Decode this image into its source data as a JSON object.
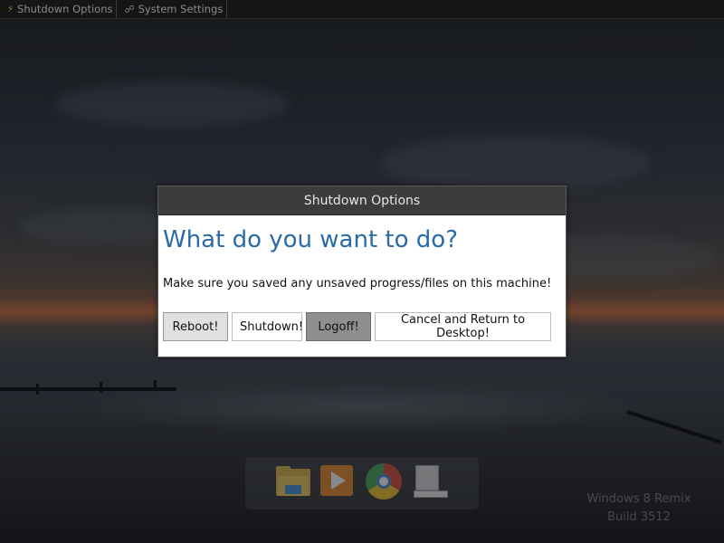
{
  "taskbar": {
    "items": [
      {
        "label": "Shutdown Options",
        "icon": "power-icon"
      },
      {
        "label": "System Settings",
        "icon": "globe-icon"
      }
    ]
  },
  "dialog": {
    "title": "Shutdown Options",
    "heading": "What do you want to do?",
    "message": "Make sure you saved any unsaved progress/files on this machine!",
    "buttons": {
      "reboot": "Reboot!",
      "shutdown": "Shutdown!",
      "logoff": "Logoff!",
      "cancel": "Cancel and Return to Desktop!"
    }
  },
  "dock": {
    "icons": [
      "folder-icon",
      "media-player-icon",
      "browser-icon",
      "computer-icon"
    ]
  },
  "watermark": {
    "line1": "Windows 8 Remix",
    "line2": "Build 3512"
  },
  "colors": {
    "heading": "#2a6aa8",
    "titlebar": "#3c3c3c",
    "logoff_button": "#8f8f8f"
  }
}
